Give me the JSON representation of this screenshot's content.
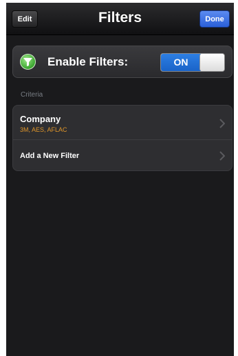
{
  "navbar": {
    "title": "Filters",
    "edit_label": "Edit",
    "done_label": "Done"
  },
  "enable": {
    "label": "Enable Filters:",
    "toggle_label": "ON",
    "enabled": true,
    "icon": "filter-funnel-icon"
  },
  "criteria": {
    "header": "Criteria",
    "rows": [
      {
        "title": "Company",
        "subtitle": "3M, AES, AFLAC",
        "icon": "chevron-right-icon"
      },
      {
        "title": "Add a New Filter",
        "icon": "chevron-right-icon"
      }
    ]
  },
  "colors": {
    "background": "#1a1a1c",
    "accent_blue": "#2a6fdb",
    "subtitle_orange": "#e0962a",
    "header_gray": "#7a7f86"
  }
}
